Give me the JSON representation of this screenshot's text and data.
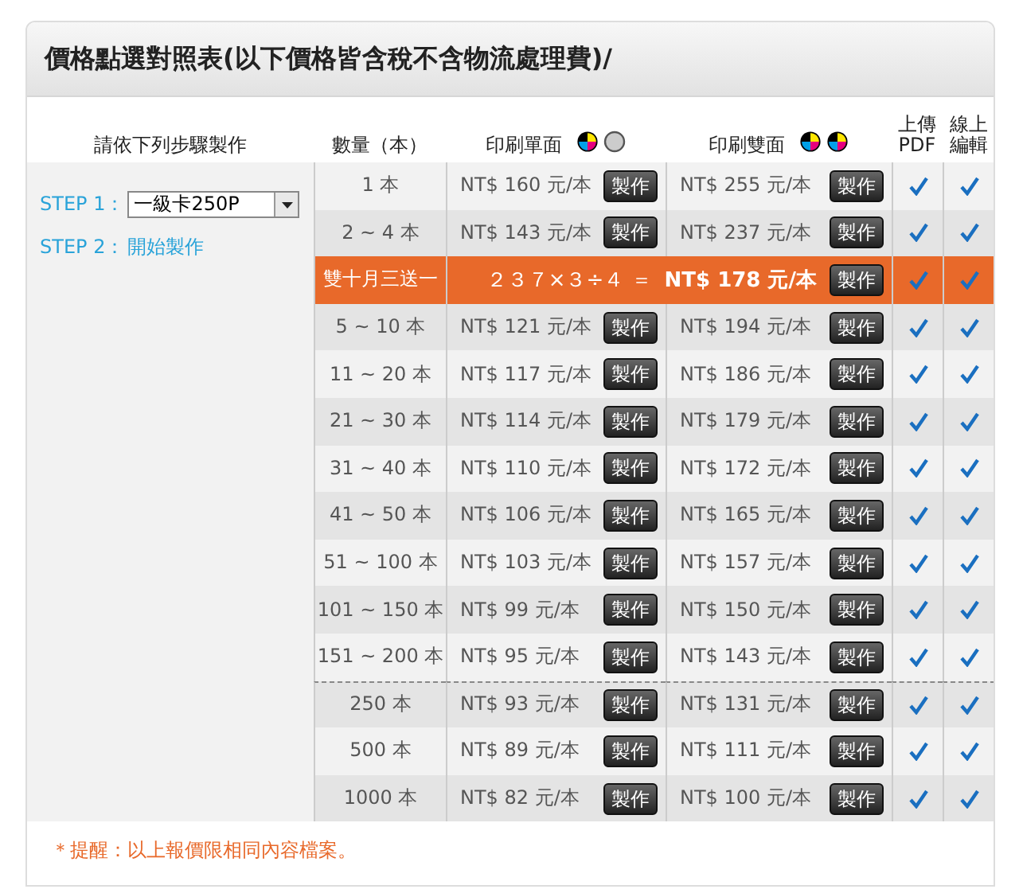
{
  "title": "價格點選對照表(以下價格皆含稅不含物流處理費)/",
  "columns": [
    {
      "lines": [
        "請依下列步驟製作"
      ]
    },
    {
      "lines": [
        "數量（本）"
      ]
    },
    {
      "lines": [
        "印刷單面"
      ]
    },
    {
      "lines": [
        "印刷雙面"
      ]
    },
    {
      "lines": [
        "上傳",
        "PDF"
      ]
    },
    {
      "lines": [
        "線上",
        "編輯"
      ]
    }
  ],
  "steps": {
    "step1_label": "STEP 1：",
    "select_value": "一級卡250P",
    "step2_label": "STEP 2：",
    "step2_link": "開始製作"
  },
  "rows": [
    {
      "kind": "regular",
      "quantity": "1 本",
      "single": "NT$ 160 元/本",
      "single_button": "製作",
      "double": "NT$ 255 元/本",
      "double_button": "製作",
      "pdf": true,
      "edit": true,
      "separator_above": false
    },
    {
      "kind": "regular",
      "quantity": "2 ~ 4 本",
      "single": "NT$ 143 元/本",
      "single_button": "製作",
      "double": "NT$ 237 元/本",
      "double_button": "製作",
      "pdf": true,
      "edit": true,
      "separator_above": false
    },
    {
      "kind": "promo",
      "quantity": "雙十月三送一",
      "single": "２３７×３÷４ ＝",
      "double": "NT$ 178 元/本",
      "double_button": "製作",
      "pdf": true,
      "edit": true,
      "separator_above": false
    },
    {
      "kind": "regular",
      "quantity": "5 ~ 10 本",
      "single": "NT$ 121 元/本",
      "single_button": "製作",
      "double": "NT$ 194 元/本",
      "double_button": "製作",
      "pdf": true,
      "edit": true,
      "separator_above": false
    },
    {
      "kind": "regular",
      "quantity": "11 ~ 20 本",
      "single": "NT$ 117 元/本",
      "single_button": "製作",
      "double": "NT$ 186 元/本",
      "double_button": "製作",
      "pdf": true,
      "edit": true,
      "separator_above": false
    },
    {
      "kind": "regular",
      "quantity": "21 ~ 30 本",
      "single": "NT$ 114 元/本",
      "single_button": "製作",
      "double": "NT$ 179 元/本",
      "double_button": "製作",
      "pdf": true,
      "edit": true,
      "separator_above": false
    },
    {
      "kind": "regular",
      "quantity": "31 ~ 40 本",
      "single": "NT$ 110 元/本",
      "single_button": "製作",
      "double": "NT$ 172 元/本",
      "double_button": "製作",
      "pdf": true,
      "edit": true,
      "separator_above": false
    },
    {
      "kind": "regular",
      "quantity": "41 ~ 50 本",
      "single": "NT$ 106 元/本",
      "single_button": "製作",
      "double": "NT$ 165 元/本",
      "double_button": "製作",
      "pdf": true,
      "edit": true,
      "separator_above": false
    },
    {
      "kind": "regular",
      "quantity": "51 ~ 100 本",
      "single": "NT$ 103 元/本",
      "single_button": "製作",
      "double": "NT$ 157 元/本",
      "double_button": "製作",
      "pdf": true,
      "edit": true,
      "separator_above": false
    },
    {
      "kind": "regular",
      "quantity": "101 ~ 150 本",
      "single": "NT$ 99 元/本",
      "single_button": "製作",
      "double": "NT$ 150 元/本",
      "double_button": "製作",
      "pdf": true,
      "edit": true,
      "separator_above": false
    },
    {
      "kind": "regular",
      "quantity": "151 ~ 200 本",
      "single": "NT$ 95 元/本",
      "single_button": "製作",
      "double": "NT$ 143 元/本",
      "double_button": "製作",
      "pdf": true,
      "edit": true,
      "separator_above": false
    },
    {
      "kind": "regular",
      "quantity": "250 本",
      "single": "NT$ 93 元/本",
      "single_button": "製作",
      "double": "NT$ 131 元/本",
      "double_button": "製作",
      "pdf": true,
      "edit": true,
      "separator_above": true
    },
    {
      "kind": "regular",
      "quantity": "500 本",
      "single": "NT$ 89 元/本",
      "single_button": "製作",
      "double": "NT$ 111 元/本",
      "double_button": "製作",
      "pdf": true,
      "edit": true,
      "separator_above": false
    },
    {
      "kind": "regular",
      "quantity": "1000 本",
      "single": "NT$ 82 元/本",
      "single_button": "製作",
      "double": "NT$ 100 元/本",
      "double_button": "製作",
      "pdf": true,
      "edit": true,
      "separator_above": false
    }
  ],
  "footnote": "＊提醒：以上報價限相同內容檔案。"
}
